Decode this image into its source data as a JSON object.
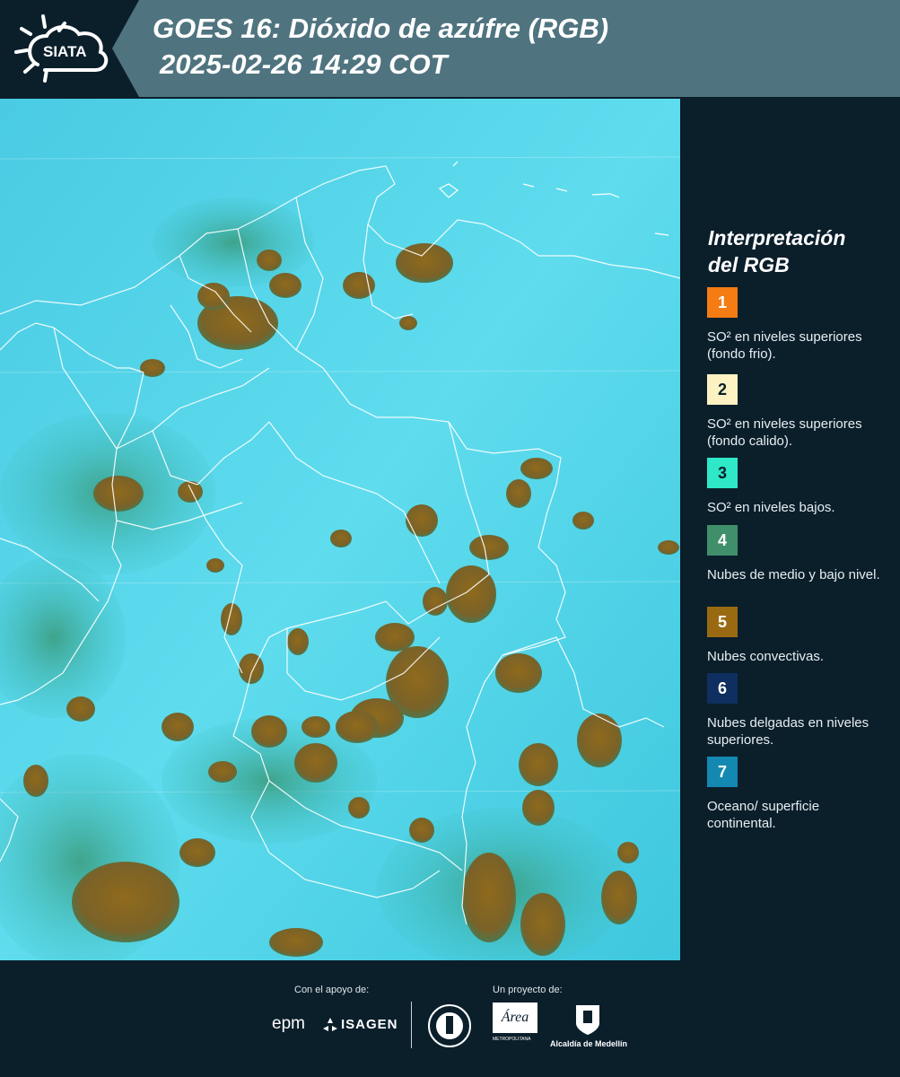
{
  "header": {
    "logo_text": "SIATA",
    "title_line1": "GOES 16: Dióxido de azúfre (RGB)",
    "title_line2": "2025-02-26 14:29 COT",
    "band_color": "#4f7480",
    "dark_color": "#0b1f2b"
  },
  "map": {
    "background_color": "#45cfe6",
    "cloud_color": "#8a6a1f",
    "border_color": "#ffffff"
  },
  "legend": {
    "title_line1": "Interpretación",
    "title_line2": "del RGB",
    "items": [
      {
        "number": "1",
        "color": "#f47c12",
        "text": "SO² en niveles superiores (fondo frio)."
      },
      {
        "number": "2",
        "color": "#fcf2c2",
        "text": "SO² en niveles superiores (fondo calido)."
      },
      {
        "number": "3",
        "color": "#2ee8c8",
        "text": "SO² en niveles bajos."
      },
      {
        "number": "4",
        "color": "#3f8f6a",
        "text": "Nubes de medio y bajo nivel."
      },
      {
        "number": "5",
        "color": "#9a6a12",
        "text": "Nubes convectivas."
      },
      {
        "number": "6",
        "color": "#0e2f5f",
        "text": "Nubes delgadas en niveles superiores."
      },
      {
        "number": "7",
        "color": "#1388b0",
        "text": "Oceano/ superficie continental."
      }
    ]
  },
  "footer": {
    "support_label": "Con el apoyo de:",
    "project_label": "Un proyecto de:",
    "sponsor1": "epm",
    "sponsor2": "ISAGEN",
    "partner1": "Área Metropolitana Valle de Aburrá",
    "partner1_short": "Área",
    "partner1_sub": "METROPOLITANA",
    "partner2": "Alcaldía de Medellín"
  }
}
